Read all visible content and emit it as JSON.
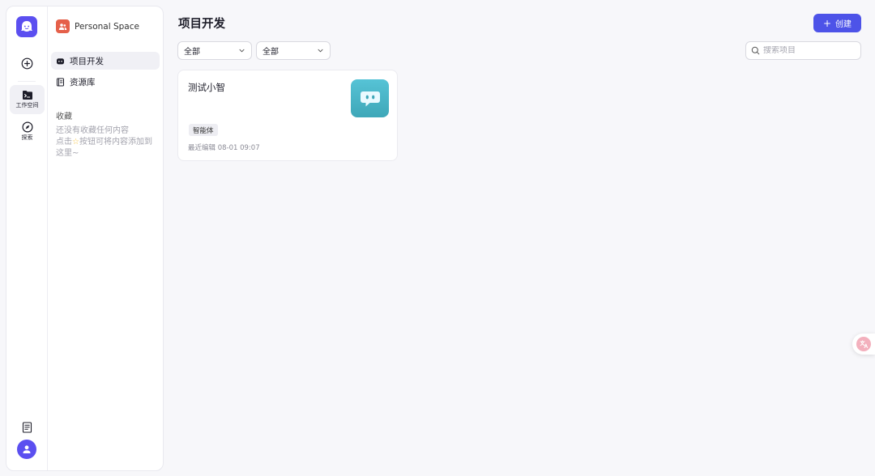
{
  "rail": {
    "workspace_label": "工作空间",
    "explore_label": "探索"
  },
  "space": {
    "name": "Personal Space"
  },
  "nav": {
    "items": [
      {
        "label": "项目开发"
      },
      {
        "label": "资源库"
      }
    ]
  },
  "favorites": {
    "title": "收藏",
    "empty_prefix": "还没有收藏任何内容",
    "empty_mid": "点击",
    "empty_suffix": "按钮可将内容添加到这里~"
  },
  "main": {
    "title": "项目开发",
    "create_label": "创建",
    "filter1": "全部",
    "filter2": "全部",
    "search_placeholder": "搜索项目"
  },
  "projects": [
    {
      "name": "测试小智",
      "tag": "智能体",
      "meta": "最近编辑 08-01 09:07"
    }
  ],
  "colors": {
    "brand": "#5b4ff0",
    "primary_button": "#4d53e8",
    "space_icon": "#e5604a",
    "card_icon": "#4bb5c7"
  }
}
